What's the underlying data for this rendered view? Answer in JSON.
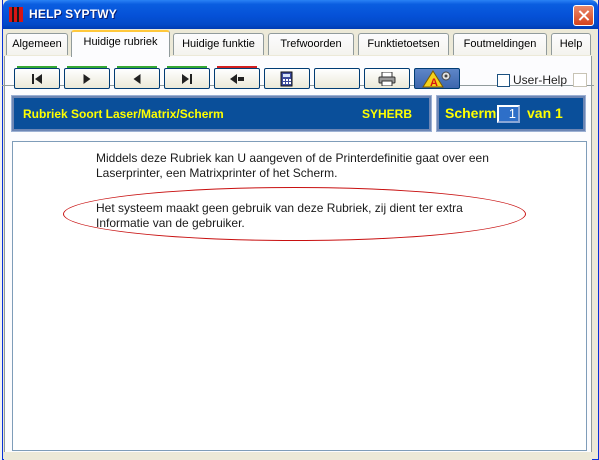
{
  "window": {
    "title": "HELP SYPTWY"
  },
  "tabs": [
    {
      "label": "Algemeen"
    },
    {
      "label": "Huidige rubriek"
    },
    {
      "label": "Huidige funktie"
    },
    {
      "label": "Trefwoorden"
    },
    {
      "label": "Funktietoetsen"
    },
    {
      "label": "Foutmeldingen"
    },
    {
      "label": "Help"
    }
  ],
  "active_tab": "Huidige rubriek",
  "toolbar": {
    "buttons": [
      {
        "icon": "first-icon"
      },
      {
        "icon": "next-icon"
      },
      {
        "icon": "previous-icon"
      },
      {
        "icon": "last-icon"
      },
      {
        "icon": "back-icon"
      },
      {
        "icon": "calculator-icon"
      },
      {
        "icon": "blank"
      },
      {
        "icon": "printer-icon"
      },
      {
        "icon": "warning-icon"
      }
    ],
    "user_help_label": "User-Help"
  },
  "header": {
    "rubriek_title": "Rubriek Soort Laser/Matrix/Scherm",
    "rubriek_code": "SYHERB",
    "scherm_label": "Scherm",
    "scherm_value": "1",
    "scherm_van": "van 1"
  },
  "content": {
    "paragraph1": "Middels deze Rubriek kan U aangeven of de Printerdefinitie gaat over een Laserprinter, een Matrixprinter of het Scherm.",
    "paragraph2": "Het systeem maakt geen gebruik van deze Rubriek, zij dient ter extra Informatie van de gebruiker."
  },
  "colors": {
    "header_bg": "#0a4f9a",
    "header_text": "#ffff00",
    "annotation": "#c81010",
    "active_tab_accent": "#ffc83c"
  }
}
